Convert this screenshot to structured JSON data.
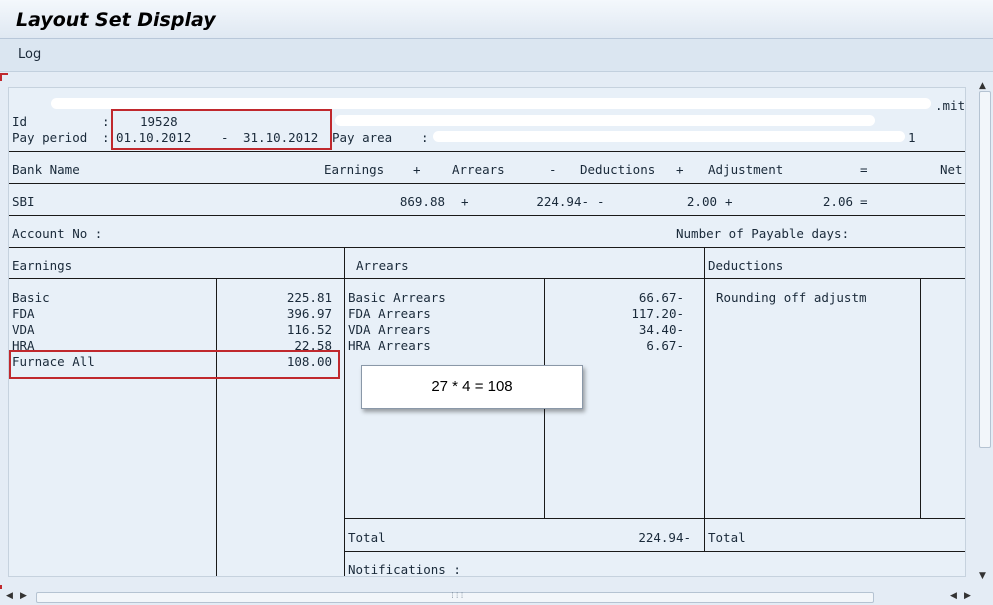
{
  "window": {
    "title": "Layout Set Display"
  },
  "menu": {
    "log": "Log"
  },
  "header": {
    "mask_suffix": ".mit",
    "id_label": "Id",
    "colon": ":",
    "id_value": "19528",
    "pay_period_label": "Pay period",
    "pay_period_start": "01.10.2012",
    "dash": "-",
    "pay_period_end": "31.10.2012",
    "pay_area_label": "Pay area",
    "pay_area_value": "1"
  },
  "bank_table": {
    "headers": {
      "bank_name": "Bank Name",
      "earnings": "Earnings",
      "plus1": "+",
      "arrears": "Arrears",
      "minus": "-",
      "deductions": "Deductions",
      "plus2": "+",
      "adjustment": "Adjustment",
      "equals": "=",
      "net": "Net"
    },
    "row": {
      "bank": "SBI",
      "earnings": "869.88",
      "plus1": "+",
      "arrears": "224.94-",
      "minus": "-",
      "deductions": "2.00",
      "plus2": "+",
      "adjustment": "2.06",
      "equals": "="
    }
  },
  "account": {
    "account_label": "Account No :",
    "payable_days_label": "Number of Payable days:"
  },
  "earnings": {
    "title": "Earnings",
    "items": [
      {
        "name": "Basic",
        "amount": "225.81"
      },
      {
        "name": "FDA",
        "amount": "396.97"
      },
      {
        "name": "VDA",
        "amount": "116.52"
      },
      {
        "name": "HRA",
        "amount": "22.58"
      },
      {
        "name": "Furnace All",
        "amount": "108.00"
      }
    ]
  },
  "arrears": {
    "title": "Arrears",
    "items": [
      {
        "name": "Basic Arrears",
        "amount": "66.67-"
      },
      {
        "name": "FDA Arrears",
        "amount": "117.20-"
      },
      {
        "name": "VDA Arrears",
        "amount": "34.40-"
      },
      {
        "name": "HRA Arrears",
        "amount": "6.67-"
      }
    ],
    "total_label": "Total",
    "total_value": "224.94-"
  },
  "deductions": {
    "title": "Deductions",
    "items": [
      {
        "name": "Rounding off adjustm"
      }
    ],
    "total_label": "Total"
  },
  "notifications_label": "Notifications :",
  "callout": {
    "text": "27 * 4 = 108"
  },
  "colors": {
    "highlight": "#c0282d",
    "background": "#e8f0f8"
  }
}
